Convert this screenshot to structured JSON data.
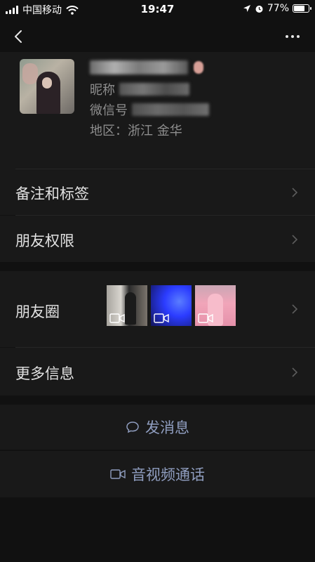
{
  "status_bar": {
    "carrier": "中国移动",
    "time": "19:47",
    "battery_percent": "77%",
    "battery_level": 0.77
  },
  "nav": {
    "back_icon": "chevron-left-icon",
    "more_icon": "more-dots-icon"
  },
  "profile": {
    "nickname_label": "昵称",
    "wechat_id_label": "微信号",
    "region": "地区：浙江 金华"
  },
  "menu": {
    "remark_tags": "备注和标签",
    "friend_permissions": "朋友权限",
    "moments": "朋友圈",
    "more_info": "更多信息"
  },
  "actions": {
    "send_message": "发消息",
    "av_call": "音视频通话"
  },
  "colors": {
    "background": "#111111",
    "cell": "#191919",
    "link": "#8f9dbf"
  }
}
